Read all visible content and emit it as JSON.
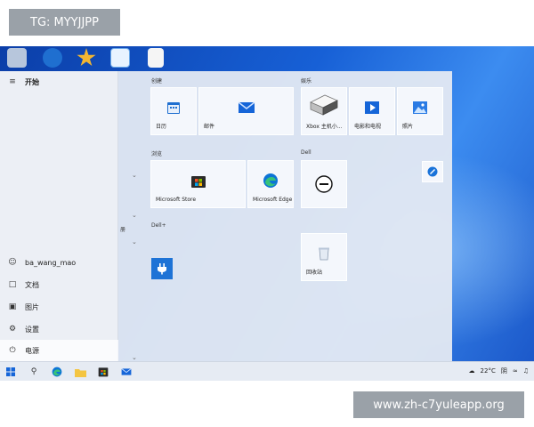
{
  "overlay": {
    "tg_text": "TG: MYYJJPP",
    "watermark": "www.zh-c7yuleapp.org"
  },
  "start_menu": {
    "title": "开始",
    "user": "ba_wang_mao",
    "items": [
      {
        "icon": "document-icon",
        "label": "文档"
      },
      {
        "icon": "picture-icon",
        "label": "图片"
      },
      {
        "icon": "gear-icon",
        "label": "设置"
      },
      {
        "icon": "power-icon",
        "label": "电源"
      }
    ],
    "side_fragment": "册"
  },
  "groups": {
    "create": "创建",
    "entertain": "娱乐",
    "browse": "浏览",
    "dell": "Dell",
    "dellplus": "Dell+"
  },
  "tiles": {
    "calendar": "日历",
    "mail": "邮件",
    "xbox": "Xbox 主机小...",
    "movies": "电影和电视",
    "photos": "照片",
    "store": "Microsoft Store",
    "edge": "Microsoft Edge",
    "recycle": "回收站"
  },
  "taskbar": {
    "temperature": "22°C",
    "weather": "阴"
  },
  "colors": {
    "accent": "#1565d8",
    "tile_bg": "#f5f8fc"
  }
}
